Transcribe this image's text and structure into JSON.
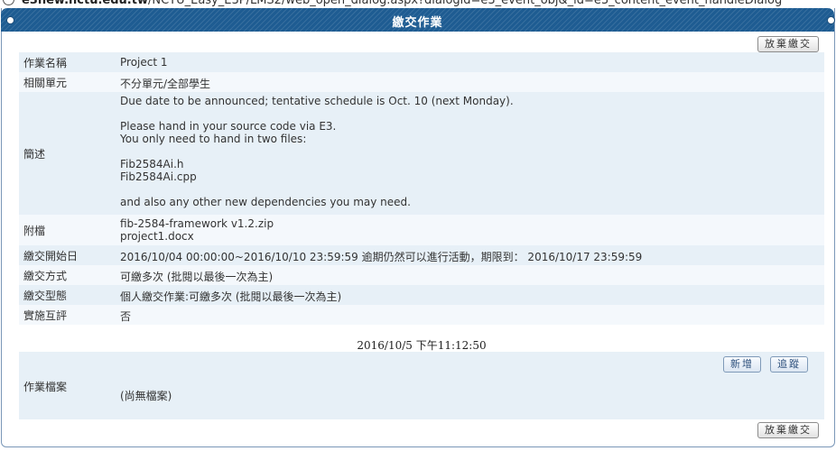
{
  "address_bar": {
    "host": "e3new.nctu.edu.tw",
    "path": "/NCTU_Easy_E3P/LMS2/web_open_dialog.aspx?dialogid=e3_event_obj&_id=e3_content_event_handleDialog"
  },
  "dialog": {
    "title": "繳交作業"
  },
  "actions": {
    "abandon_top": "放棄繳交",
    "abandon_bottom": "放棄繳交",
    "add": "新增",
    "track": "追蹤"
  },
  "details": {
    "name_label": "作業名稱",
    "name_value": "Project 1",
    "unit_label": "相關單元",
    "unit_value": "不分單元/全部學生",
    "desc_label": "簡述",
    "desc_lines": [
      "Due date to be announced; tentative schedule is Oct. 10 (next Monday).",
      "Please hand in your source code via E3.",
      "You only need to hand in two files:",
      "Fib2584Ai.h",
      "Fib2584Ai.cpp",
      "and also any other new dependencies you may need."
    ],
    "attach_label": "附檔",
    "attachments": [
      "fib-2584-framework v1.2.zip",
      "project1.docx"
    ],
    "start_label": "繳交開始日",
    "start_value": "2016/10/04 00:00:00~2016/10/10 23:59:59 逾期仍然可以進行活動，期限到： 2016/10/17 23:59:59",
    "method_label": "繳交方式",
    "method_value": "可繳多次 (批閱以最後一次為主)",
    "type_label": "繳交型態",
    "type_value": "個人繳交作業:可繳多次 (批閱以最後一次為主)",
    "peer_label": "實施互評",
    "peer_value": "否"
  },
  "timestamp": "2016/10/5 下午11:12:50",
  "files_section": {
    "label": "作業檔案",
    "empty_text": "(尚無檔案)"
  }
}
